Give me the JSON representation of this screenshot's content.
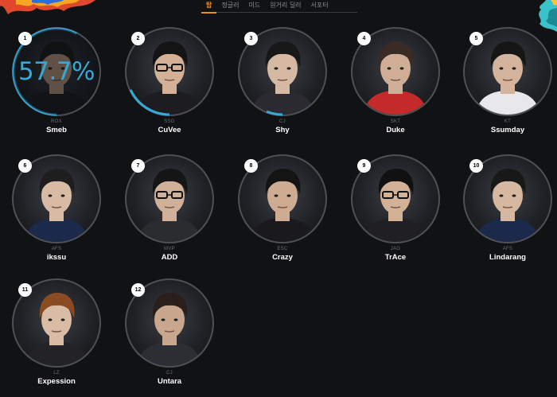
{
  "tabs": [
    {
      "label": "탑",
      "active": true
    },
    {
      "label": "정글러",
      "active": false
    },
    {
      "label": "미드",
      "active": false
    },
    {
      "label": "원거리 딜러",
      "active": false
    },
    {
      "label": "서포터",
      "active": false
    }
  ],
  "players": [
    {
      "rank": "1",
      "team": "ROX",
      "name": "Smeb",
      "winrate": "57.7%",
      "hovered": true,
      "progress": 0.577,
      "skin": "#c9a48a",
      "hair": "#1a1a1a",
      "shirt": "#1c1c20",
      "glasses": false
    },
    {
      "rank": "2",
      "team": "SSG",
      "name": "CuVee",
      "progress": 0.18,
      "skin": "#d3b096",
      "hair": "#141414",
      "shirt": "#1d1d21",
      "glasses": true
    },
    {
      "rank": "3",
      "team": "CJ",
      "name": "Shy",
      "progress": 0.06,
      "skin": "#d6b9a2",
      "hair": "#181818",
      "shirt": "#2a2a30",
      "glasses": false
    },
    {
      "rank": "4",
      "team": "SKT",
      "name": "Duke",
      "progress": 0,
      "skin": "#cfae95",
      "hair": "#3a2c24",
      "shirt": "#c42a2a",
      "glasses": false
    },
    {
      "rank": "5",
      "team": "KT",
      "name": "Ssumday",
      "progress": 0,
      "skin": "#d4b49c",
      "hair": "#161616",
      "shirt": "#e8e8ea",
      "glasses": false
    },
    {
      "rank": "6",
      "team": "AFS",
      "name": "ikssu",
      "progress": 0,
      "skin": "#d8bba5",
      "hair": "#1e1e1e",
      "shirt": "#1b2a4a",
      "glasses": false
    },
    {
      "rank": "7",
      "team": "MVP",
      "name": "ADD",
      "progress": 0,
      "skin": "#d0b099",
      "hair": "#151515",
      "shirt": "#2a2c30",
      "glasses": true
    },
    {
      "rank": "8",
      "team": "ESC",
      "name": "Crazy",
      "progress": 0,
      "skin": "#cdac92",
      "hair": "#141414",
      "shirt": "#1a1a1e",
      "glasses": false
    },
    {
      "rank": "9",
      "team": "JAG",
      "name": "TrAce",
      "progress": 0,
      "skin": "#d2b197",
      "hair": "#111111",
      "shirt": "#1f1f24",
      "glasses": true
    },
    {
      "rank": "10",
      "team": "AFS",
      "name": "Lindarang",
      "progress": 0,
      "skin": "#d6b7a0",
      "hair": "#181818",
      "shirt": "#1b2a4a",
      "glasses": false
    },
    {
      "rank": "11",
      "team": "LZ",
      "name": "Expession",
      "progress": 0,
      "skin": "#d9bca6",
      "hair": "#8a4a22",
      "shirt": "#232327",
      "glasses": false
    },
    {
      "rank": "12",
      "team": "CJ",
      "name": "Untara",
      "progress": 0,
      "skin": "#c9a78e",
      "hair": "#2a1f1a",
      "shirt": "#2c2e34",
      "glasses": false
    }
  ],
  "colors": {
    "accent": "#f08a24",
    "winrate": "#35a9d8",
    "background": "#111214"
  }
}
